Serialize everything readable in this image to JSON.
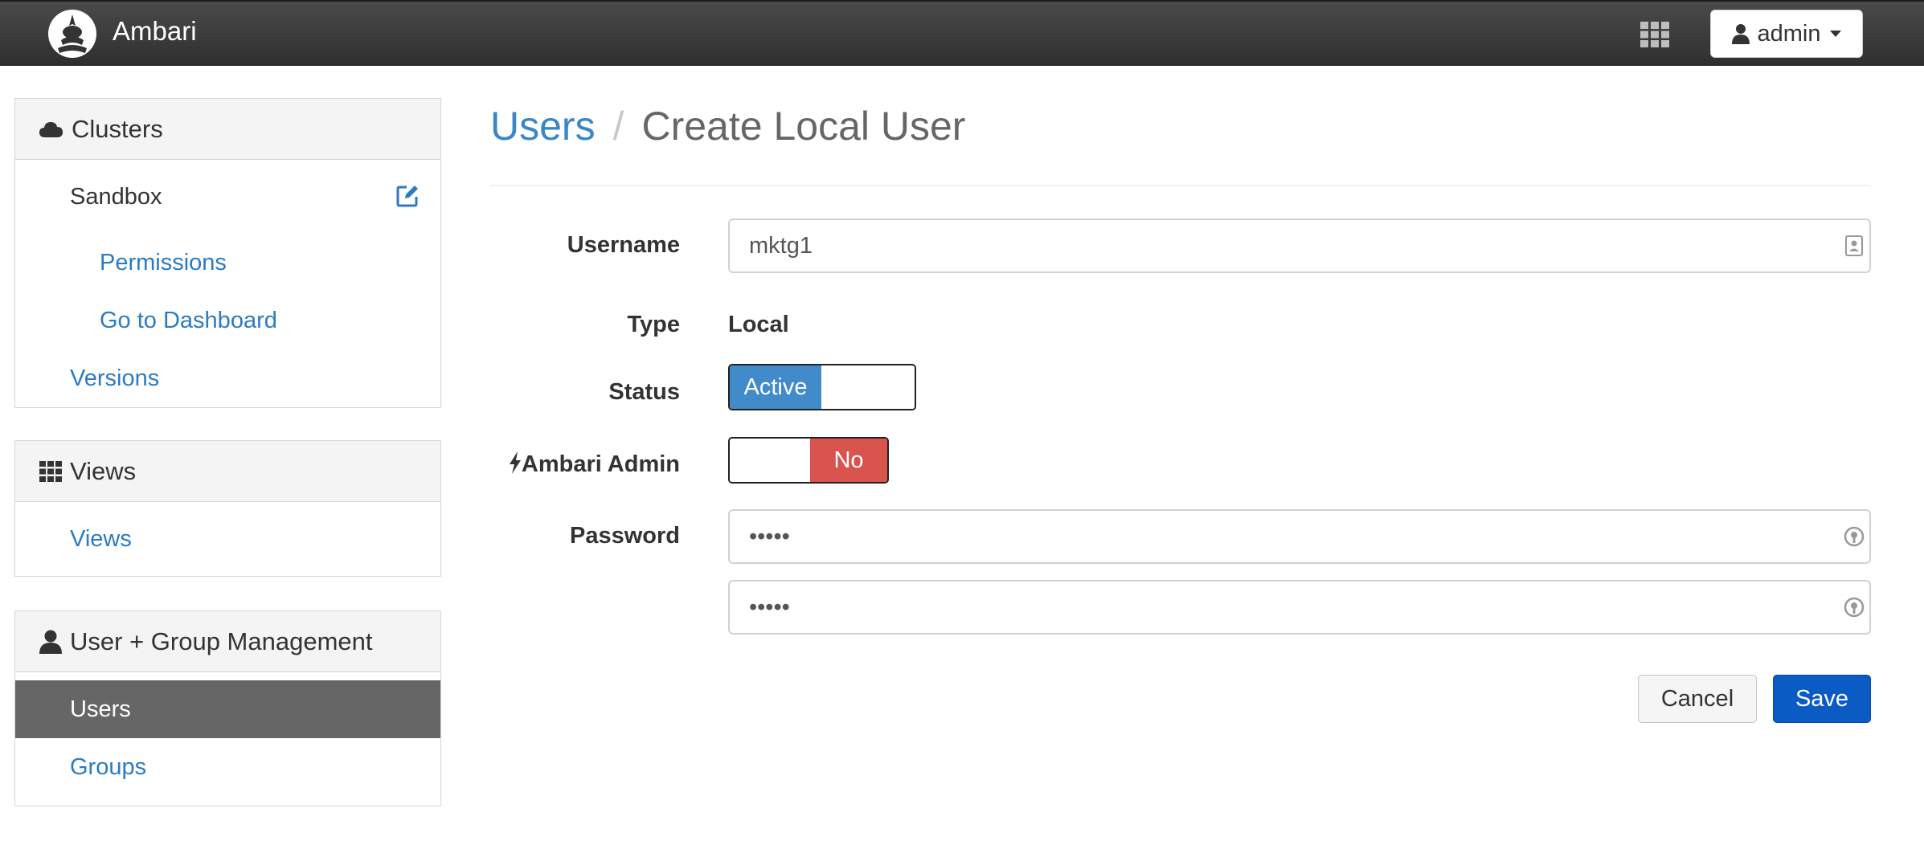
{
  "app": {
    "brand": "Ambari",
    "user_menu_label": "admin"
  },
  "sidebar": {
    "clusters": {
      "header": "Clusters",
      "cluster_name": "Sandbox",
      "items": [
        {
          "label": "Permissions"
        },
        {
          "label": "Go to Dashboard"
        }
      ],
      "versions_label": "Versions"
    },
    "views": {
      "header": "Views",
      "items": [
        {
          "label": "Views"
        }
      ]
    },
    "user_group": {
      "header": "User + Group Management",
      "items": [
        {
          "label": "Users",
          "active": true
        },
        {
          "label": "Groups",
          "active": false
        }
      ]
    }
  },
  "breadcrumb": {
    "parent": "Users",
    "separator": "/",
    "current": "Create Local User"
  },
  "form": {
    "username_label": "Username",
    "username_value": "mktg1",
    "type_label": "Type",
    "type_value": "Local",
    "status_label": "Status",
    "status_value": "Active",
    "admin_label": "Ambari Admin",
    "admin_value": "No",
    "password_label": "Password",
    "password_value": "•••••",
    "password_confirm_value": "•••••"
  },
  "actions": {
    "cancel_label": "Cancel",
    "save_label": "Save"
  },
  "colors": {
    "navbar": "#3a3a3a",
    "link": "#2b7bc3",
    "active_toggle": "#428bca",
    "no_toggle": "#d9534f",
    "save_button": "#0a5bc4",
    "active_nav": "#666666"
  }
}
